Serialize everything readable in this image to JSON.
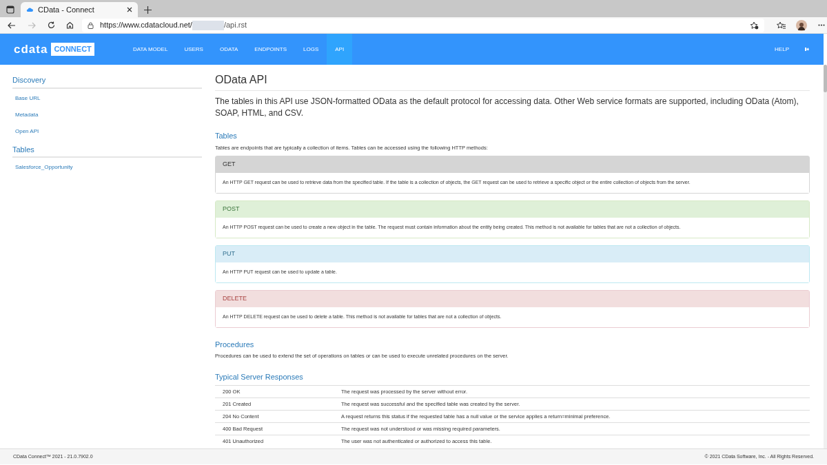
{
  "browser": {
    "tab_title": "CData - Connect",
    "url_start": "https://www.cdatacloud.net/",
    "url_end": "/api.rst"
  },
  "navbar": {
    "logo_text": "cdata",
    "logo_badge": "CONNECT",
    "items": [
      {
        "label": "DATA MODEL",
        "selected": false
      },
      {
        "label": "USERS",
        "selected": false
      },
      {
        "label": "ODATA",
        "selected": false
      },
      {
        "label": "ENDPOINTS",
        "selected": false
      },
      {
        "label": "LOGS",
        "selected": false
      },
      {
        "label": "API",
        "selected": true
      }
    ],
    "help": "HELP"
  },
  "sidebar": {
    "sections": [
      {
        "title": "Discovery",
        "items": [
          "Base URL",
          "Metadata",
          "Open API"
        ]
      },
      {
        "title": "Tables",
        "items": [
          "Salesforce_Opportunity"
        ]
      }
    ]
  },
  "content": {
    "title": "OData API",
    "intro": "The tables in this API use JSON-formatted OData as the default protocol for accessing data. Other Web service formats are supported, including OData (Atom), SOAP, HTML, and CSV.",
    "tables_heading": "Tables",
    "tables_text": "Tables are endpoints that are typically a collection of items. Tables can be accessed using the following HTTP methods:",
    "methods": [
      {
        "kind": "get",
        "name": "GET",
        "description": "An HTTP GET request can be used to retrieve data from the specified table. If the table is a collection of objects, the GET request can be used to retrieve a specific object or the entire collection of objects from the server."
      },
      {
        "kind": "post",
        "name": "POST",
        "description": "An HTTP POST request can be used to create a new object in the table. The request must contain information about the entity being created. This method is not available for tables that are not a collection of objects."
      },
      {
        "kind": "put",
        "name": "PUT",
        "description": "An HTTP PUT request can be used to update a table."
      },
      {
        "kind": "delete",
        "name": "DELETE",
        "description": "An HTTP DELETE request can be used to delete a table. This method is not available for tables that are not a collection of objects."
      }
    ],
    "procedures_heading": "Procedures",
    "procedures_text": "Procedures can be used to extend the set of operations on tables or can be used to execute unrelated procedures on the server.",
    "responses_heading": "Typical Server Responses",
    "responses": [
      {
        "code": "200 OK",
        "description": "The request was processed by the server without error."
      },
      {
        "code": "201 Created",
        "description": "The request was successful and the specified table was created by the server."
      },
      {
        "code": "204 No Content",
        "description": "A request returns this status if the requested table has a null value or the service applies a return=minimal preference."
      },
      {
        "code": "400 Bad Request",
        "description": "The request was not understood or was missing required parameters."
      },
      {
        "code": "401 Unauthorized",
        "description": "The user was not authenticated or authorized to access this table."
      }
    ]
  },
  "footer": {
    "version": "CData Connect™ 2021 - 21.0.7902.0",
    "copyright": "© 2021 CData Software, Inc. - All Rights Reserved."
  }
}
